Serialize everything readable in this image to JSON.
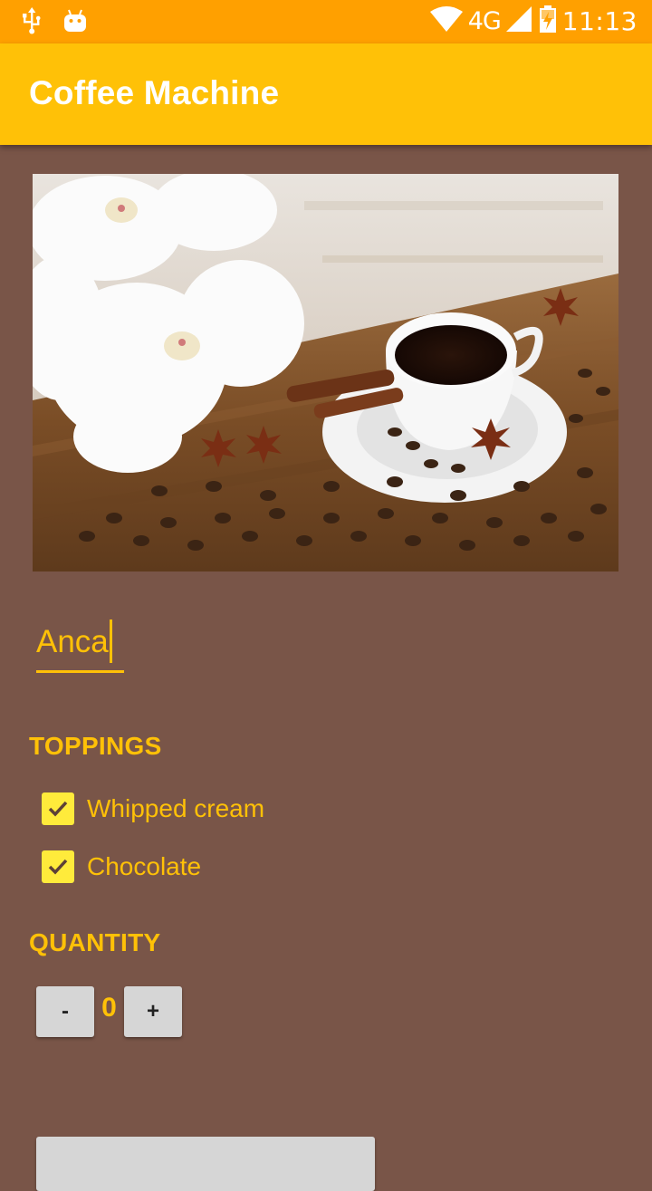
{
  "status_bar": {
    "time": "11:13",
    "network": "4G",
    "icons": [
      "usb-icon",
      "android-icon",
      "wifi-icon",
      "signal-icon",
      "battery-charging-icon"
    ]
  },
  "app_bar": {
    "title": "Coffee Machine",
    "color": "#FFC107"
  },
  "hero_image": {
    "description_icon": "coffee-cup-with-orchids-photo"
  },
  "name_input": {
    "value": "Anca"
  },
  "toppings": {
    "title": "TOPPINGS",
    "items": [
      {
        "label": "Whipped cream",
        "checked": true
      },
      {
        "label": "Chocolate",
        "checked": true
      }
    ]
  },
  "quantity": {
    "title": "QUANTITY",
    "decrement_label": "-",
    "increment_label": "+",
    "value": "0"
  },
  "colors": {
    "background": "#795548",
    "accent": "#FFC107",
    "status_bar": "#FFA000",
    "checkbox": "#FFEB3B"
  }
}
